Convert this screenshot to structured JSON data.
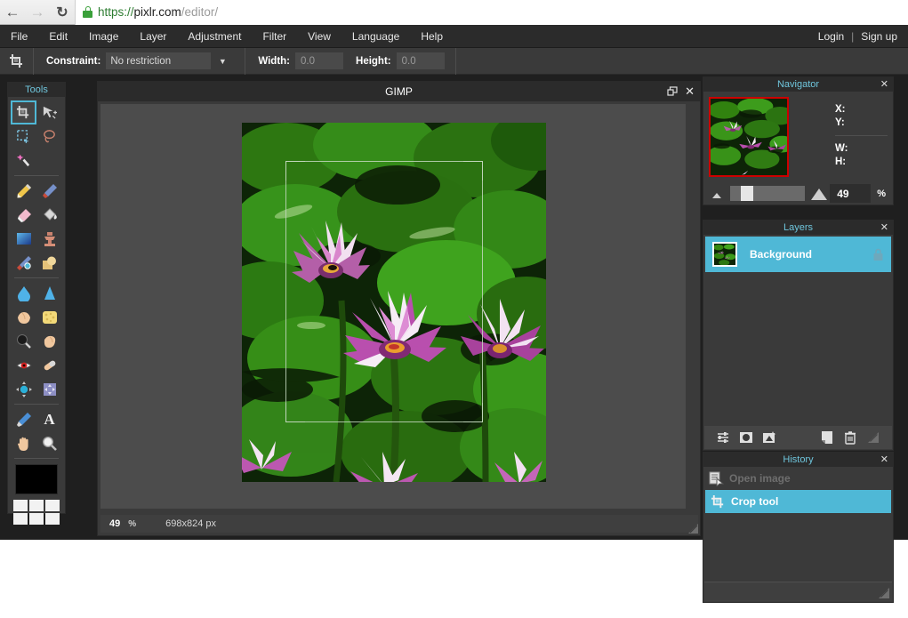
{
  "browser": {
    "back_icon": "arrow-left-icon",
    "forward_icon": "arrow-right-icon",
    "reload_icon": "reload-icon",
    "lock_icon": "lock-icon",
    "url_scheme": "https://",
    "url_host": "pixlr.com",
    "url_path": "/editor/"
  },
  "menubar": {
    "items": [
      {
        "label": "File"
      },
      {
        "label": "Edit"
      },
      {
        "label": "Image"
      },
      {
        "label": "Layer"
      },
      {
        "label": "Adjustment"
      },
      {
        "label": "Filter"
      },
      {
        "label": "View"
      },
      {
        "label": "Language"
      },
      {
        "label": "Help"
      }
    ],
    "account": {
      "login": "Login",
      "separator": "|",
      "signup": "Sign up"
    }
  },
  "options_bar": {
    "tool_icon": "crop-tool-icon",
    "constraint_label": "Constraint:",
    "constraint_value": "No restriction",
    "constraint_caret": "chevron-down-icon",
    "width_label": "Width:",
    "width_value": "0.0",
    "height_label": "Height:",
    "height_value": "0.0"
  },
  "tools_panel": {
    "title": "Tools",
    "selected_tool": "crop-tool",
    "rows": [
      [
        {
          "name": "crop-tool",
          "icon": "crop-tool-icon",
          "selected": true
        },
        {
          "name": "move-tool",
          "icon": "move-arrow-icon",
          "selected": false
        }
      ],
      [
        {
          "name": "marquee-select-tool",
          "icon": "marquee-select-icon",
          "selected": false
        },
        {
          "name": "lasso-tool",
          "icon": "lasso-icon",
          "selected": false
        }
      ],
      [
        {
          "name": "wand-select-tool",
          "icon": "magic-wand-icon",
          "selected": false
        }
      ],
      [
        {
          "name": "pencil-tool",
          "icon": "pencil-icon",
          "selected": false
        },
        {
          "name": "brush-tool",
          "icon": "paintbrush-icon",
          "selected": false
        }
      ],
      [
        {
          "name": "eraser-tool",
          "icon": "eraser-icon",
          "selected": false
        },
        {
          "name": "paint-bucket-tool",
          "icon": "paint-bucket-icon",
          "selected": false
        }
      ],
      [
        {
          "name": "gradient-tool",
          "icon": "gradient-icon",
          "selected": false
        },
        {
          "name": "clone-stamp-tool",
          "icon": "clone-stamp-icon",
          "selected": false
        }
      ],
      [
        {
          "name": "color-replace-tool",
          "icon": "color-replace-icon",
          "selected": false
        },
        {
          "name": "drawing-tool",
          "icon": "drawing-shape-icon",
          "selected": false
        }
      ],
      [
        {
          "name": "blur-tool",
          "icon": "water-drop-icon",
          "selected": false
        },
        {
          "name": "sharpen-tool",
          "icon": "sharpen-cone-icon",
          "selected": false
        }
      ],
      [
        {
          "name": "smudge-tool",
          "icon": "smudge-finger-icon",
          "selected": false
        },
        {
          "name": "sponge-tool",
          "icon": "sponge-icon",
          "selected": false
        }
      ],
      [
        {
          "name": "dodge-tool",
          "icon": "dodge-icon",
          "selected": false
        },
        {
          "name": "burn-tool",
          "icon": "burn-hand-icon",
          "selected": false
        }
      ],
      [
        {
          "name": "red-eye-tool",
          "icon": "red-eye-icon",
          "selected": false
        },
        {
          "name": "spot-heal-tool",
          "icon": "bandage-icon",
          "selected": false
        }
      ],
      [
        {
          "name": "bloat-tool",
          "icon": "bloat-icon",
          "selected": false
        },
        {
          "name": "pinch-tool",
          "icon": "pinch-icon",
          "selected": false
        }
      ],
      [
        {
          "name": "color-picker-tool",
          "icon": "eyedropper-icon",
          "selected": false
        },
        {
          "name": "type-tool",
          "icon": "text-a-icon",
          "selected": false
        }
      ],
      [
        {
          "name": "hand-tool",
          "icon": "hand-icon",
          "selected": false
        },
        {
          "name": "zoom-tool",
          "icon": "magnifier-icon",
          "selected": false
        }
      ]
    ],
    "primary_color": "#000000",
    "palette_color": "#f2f2f2"
  },
  "image_window": {
    "title": "GIMP",
    "restore_icon": "restore-window-icon",
    "close_icon": "close-icon",
    "status": {
      "zoom": "49",
      "zoom_unit": "%",
      "dimensions": "698x824 px"
    },
    "resize_grip": "resize-grip-icon",
    "crop_selection": {
      "handle_icon": "crop-handle"
    }
  },
  "navigator": {
    "title": "Navigator",
    "close_icon": "close-icon",
    "fields": [
      {
        "label": "X:",
        "value": ""
      },
      {
        "label": "Y:",
        "value": ""
      },
      {
        "label": "W:",
        "value": ""
      },
      {
        "label": "H:",
        "value": ""
      }
    ],
    "zoom_out_icon": "zoom-out-small-mountain-icon",
    "zoom_in_icon": "zoom-in-large-mountain-icon",
    "zoom_value": "49",
    "zoom_unit": "%",
    "view_rect_color": "#cc0000"
  },
  "layers": {
    "title": "Layers",
    "close_icon": "close-icon",
    "items": [
      {
        "name": "Background",
        "locked": true,
        "selected": true,
        "lock_icon": "lock-icon"
      }
    ],
    "toolbar": [
      {
        "name": "layer-settings-button",
        "icon": "sliders-icon"
      },
      {
        "name": "layer-mask-button",
        "icon": "mask-circle-icon"
      },
      {
        "name": "add-layer-button",
        "icon": "add-layer-star-icon"
      },
      {
        "name": "duplicate-layer-button",
        "icon": "duplicate-layer-icon"
      },
      {
        "name": "delete-layer-button",
        "icon": "trash-icon"
      },
      {
        "name": "panel-resize-handle",
        "icon": "resize-grip-icon"
      }
    ]
  },
  "history": {
    "title": "History",
    "close_icon": "close-icon",
    "items": [
      {
        "label": "Open image",
        "icon": "open-image-icon",
        "selected": false
      },
      {
        "label": "Crop tool",
        "icon": "crop-tool-icon",
        "selected": true
      }
    ],
    "resize_grip": "resize-grip-icon"
  },
  "colors": {
    "accent_cyan": "#4fb8d6",
    "panel_bg": "#3a3a3a",
    "panel_title_bg": "#2b2b2b",
    "title_text": "#6fc6dd",
    "workspace_bg": "#1f1f1f",
    "canvas_bg": "#4c4c4c"
  }
}
